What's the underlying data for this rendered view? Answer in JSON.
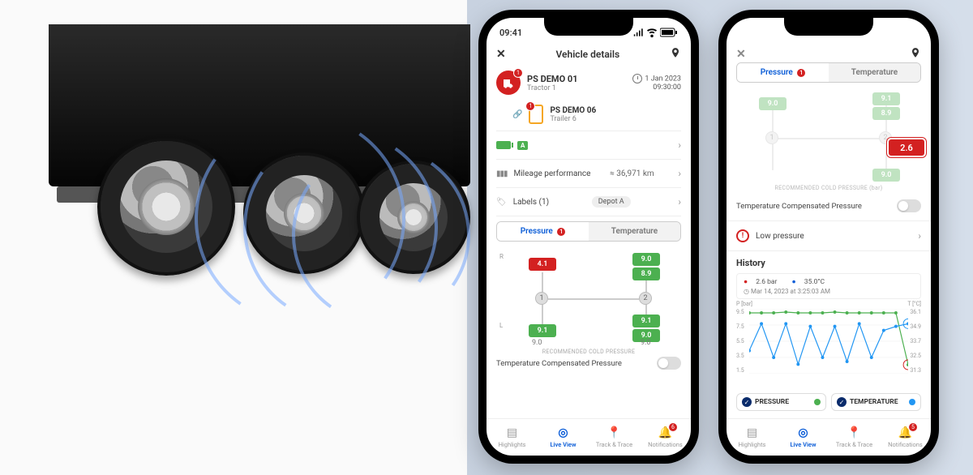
{
  "statusbar": {
    "time": "09:41"
  },
  "phone1": {
    "header": {
      "title": "Vehicle details"
    },
    "vehicle": {
      "name": "PS DEMO 01",
      "sub": "Tractor 1",
      "alert_count": "1",
      "date": "1 Jan 2023",
      "time": "09:30:00"
    },
    "trailer": {
      "name": "PS DEMO 06",
      "sub": "Trailer 6",
      "alert_count": "1"
    },
    "status_chip": "A",
    "mileage": {
      "label": "Mileage performance",
      "value": "≈ 36,971 km"
    },
    "labels": {
      "label": "Labels (1)",
      "chip": "Depot A"
    },
    "tabs": {
      "pressure": "Pressure",
      "temperature": "Temperature",
      "pressure_badge": "1"
    },
    "tires": {
      "R_front": {
        "value": "4.1",
        "state": "red"
      },
      "L_front": {
        "value": "9.1",
        "state": "green"
      },
      "R_rear_outer": {
        "value": "9.0",
        "state": "green"
      },
      "R_rear_inner": {
        "value": "8.9",
        "state": "green"
      },
      "L_rear_inner": {
        "value": "9.1",
        "state": "green"
      },
      "L_rear_outer": {
        "value": "9.0",
        "state": "green"
      },
      "rec_front": "9.0",
      "rec_rear": "9.0",
      "rec_label": "RECOMMENDED COLD PRESSURE"
    },
    "tcp_label": "Temperature Compensated Pressure",
    "nav": {
      "highlights": "Highlights",
      "live": "Live View",
      "track": "Track & Trace",
      "notif": "Notifications",
      "notif_count": "6"
    }
  },
  "phone2": {
    "tabs": {
      "pressure": "Pressure",
      "temperature": "Temperature",
      "pressure_badge": "1"
    },
    "tires": {
      "R_front": {
        "value": "9.0",
        "state": "green"
      },
      "L_top1": {
        "value": "9.1",
        "state": "green"
      },
      "L_top2": {
        "value": "8.9",
        "state": "green"
      },
      "R_rear": {
        "value": "2.6",
        "state": "red"
      },
      "L_bottom": {
        "value": "9.0",
        "state": "green"
      },
      "rec_label": "RECOMMENDED COLD PRESSURE (bar)"
    },
    "tcp_label": "Temperature Compensated Pressure",
    "alert": "Low pressure",
    "history_title": "History",
    "legend": {
      "pressure": "2.6 bar",
      "temperature": "35.0°C",
      "timestamp": "Mar 14, 2023 at 3:25:03 AM"
    },
    "axes": {
      "left_label": "P [bar]",
      "right_label": "T [°C]",
      "left_ticks": [
        "9.5",
        "7.5",
        "5.5",
        "3.5",
        "1.5"
      ],
      "right_ticks": [
        "36.1",
        "34.9",
        "33.7",
        "32.5",
        "31.3"
      ]
    },
    "series_tabs": {
      "pressure": "PRESSURE",
      "temperature": "TEMPERATURE"
    },
    "nav": {
      "highlights": "Highlights",
      "live": "Live View",
      "track": "Track & Trace",
      "notif": "Notifications",
      "notif_count": "5"
    }
  },
  "chart_data": {
    "type": "line",
    "x": [
      1,
      2,
      3,
      4,
      5,
      6,
      7,
      8,
      9,
      10,
      11,
      12,
      13,
      14
    ],
    "y_left": {
      "label": "P [bar]",
      "range": [
        1.5,
        9.5
      ]
    },
    "y_right": {
      "label": "T [°C]",
      "range": [
        31.3,
        36.1
      ]
    },
    "series": [
      {
        "name": "PRESSURE",
        "axis": "left",
        "color": "#4cb050",
        "values": [
          9.0,
          9.0,
          9.0,
          9.1,
          9.0,
          9.0,
          9.0,
          9.1,
          9.0,
          9.0,
          9.0,
          9.0,
          9.0,
          2.6
        ]
      },
      {
        "name": "TEMPERATURE",
        "axis": "right",
        "color": "#2196f3",
        "values": [
          33.0,
          35.0,
          32.5,
          35.0,
          32.0,
          34.8,
          32.5,
          34.8,
          32.2,
          35.0,
          32.5,
          34.5,
          34.8,
          35.0
        ]
      }
    ],
    "highlight_index": 13,
    "highlight": {
      "pressure": 2.6,
      "temperature": 35.0
    }
  }
}
